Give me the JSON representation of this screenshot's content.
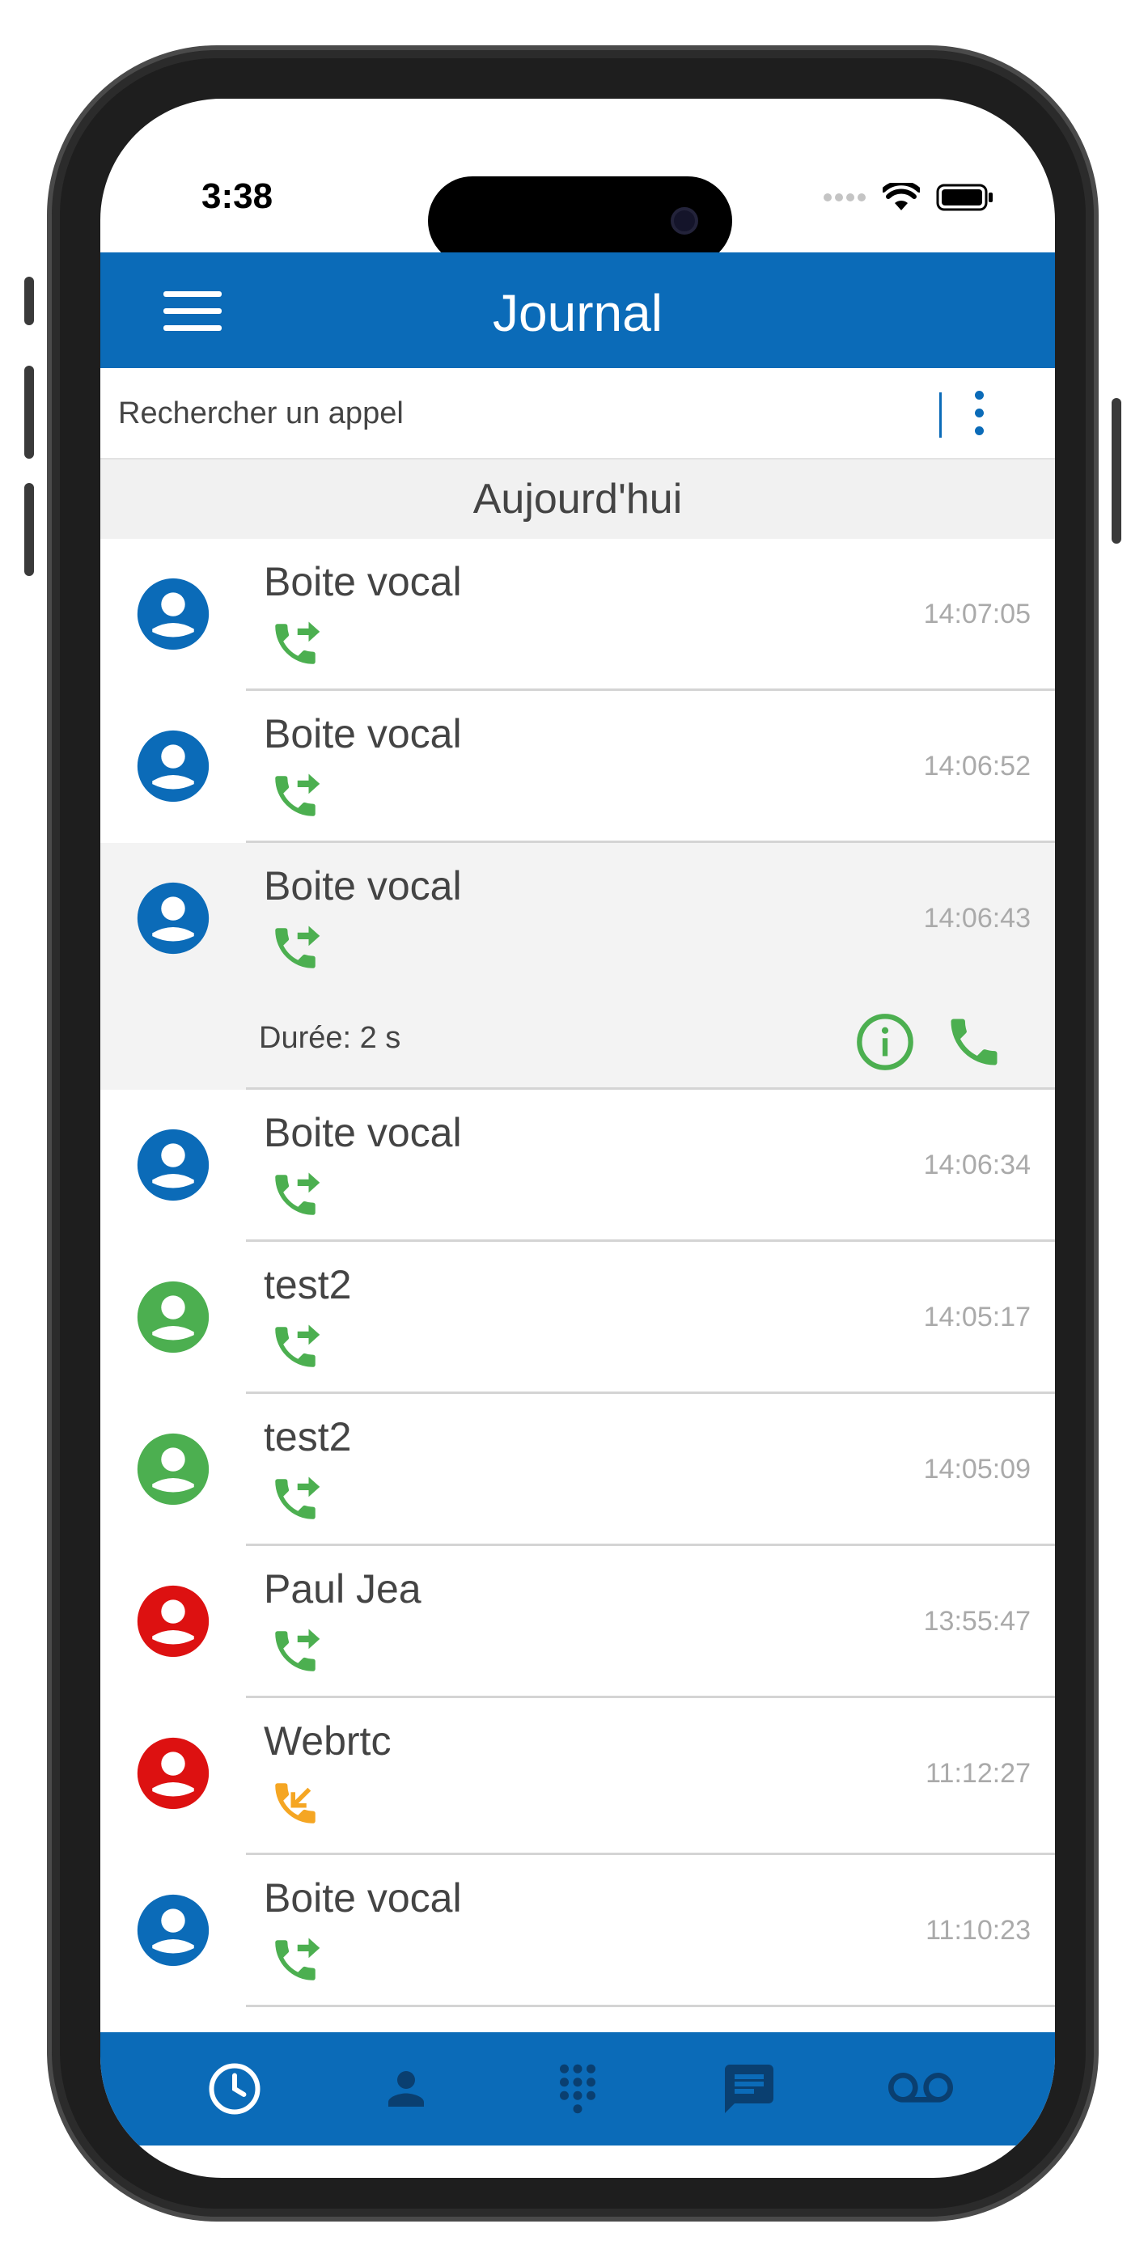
{
  "status_bar": {
    "time": "3:38"
  },
  "header": {
    "title": "Journal"
  },
  "search": {
    "placeholder": "Rechercher un appel"
  },
  "section": {
    "title": "Aujourd'hui"
  },
  "colors": {
    "brand": "#0b6bb8",
    "green": "#4caf50",
    "red": "#dd1111",
    "orange": "#f5a623"
  },
  "calls": [
    {
      "name": "Boite vocal",
      "time": "14:07:05",
      "avatar_color": "blue",
      "direction": "outgoing"
    },
    {
      "name": "Boite vocal",
      "time": "14:06:52",
      "avatar_color": "blue",
      "direction": "outgoing"
    },
    {
      "name": "Boite vocal",
      "time": "14:06:43",
      "avatar_color": "blue",
      "direction": "outgoing",
      "expanded": true,
      "duration": "Durée: 2 s"
    },
    {
      "name": "Boite vocal",
      "time": "14:06:34",
      "avatar_color": "blue",
      "direction": "outgoing"
    },
    {
      "name": "test2",
      "time": "14:05:17",
      "avatar_color": "green",
      "direction": "outgoing"
    },
    {
      "name": "test2",
      "time": "14:05:09",
      "avatar_color": "green",
      "direction": "outgoing"
    },
    {
      "name": "Paul Jea",
      "time": "13:55:47",
      "avatar_color": "red",
      "direction": "outgoing"
    },
    {
      "name": "Webrtc",
      "time": "11:12:27",
      "avatar_color": "red",
      "direction": "incoming"
    },
    {
      "name": "Boite vocal",
      "time": "11:10:23",
      "avatar_color": "blue",
      "direction": "outgoing"
    }
  ],
  "tabs": [
    {
      "icon": "clock-icon",
      "active": true
    },
    {
      "icon": "contact-icon",
      "active": false
    },
    {
      "icon": "dialpad-icon",
      "active": false
    },
    {
      "icon": "message-icon",
      "active": false
    },
    {
      "icon": "voicemail-icon",
      "active": false
    }
  ]
}
